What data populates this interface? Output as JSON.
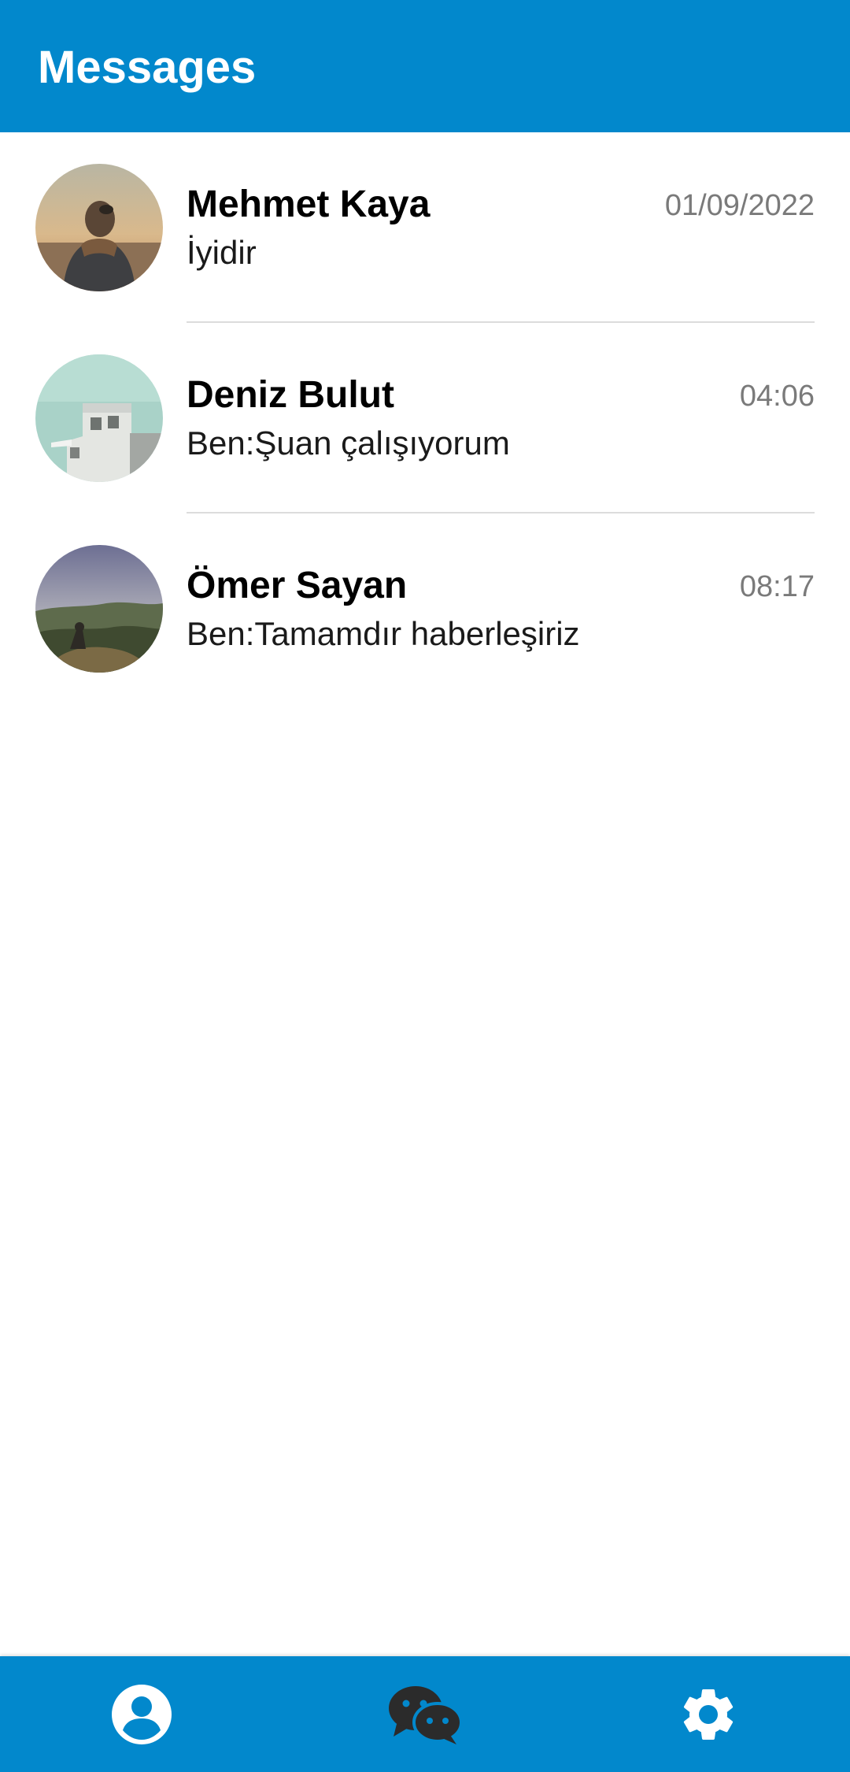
{
  "app_bar": {
    "title": "Messages",
    "color": "#0288cc"
  },
  "chats": [
    {
      "name": "Mehmet Kaya",
      "time": "01/09/2022",
      "last_message": "İyidir",
      "avatar": "person-photo"
    },
    {
      "name": "Deniz Bulut",
      "time": "04:06",
      "last_message": "Ben:Şuan çalışıyorum",
      "avatar": "building-photo"
    },
    {
      "name": "Ömer Sayan",
      "time": "08:17",
      "last_message": "Ben:Tamamdır haberleşiriz",
      "avatar": "landscape-photo"
    }
  ],
  "bottom_nav": {
    "items": [
      {
        "icon": "account-circle-icon",
        "active": false
      },
      {
        "icon": "chat-bubbles-icon",
        "active": true
      },
      {
        "icon": "gear-icon",
        "active": false
      }
    ],
    "active_color": "#2b2b2b",
    "inactive_color": "#ffffff"
  }
}
